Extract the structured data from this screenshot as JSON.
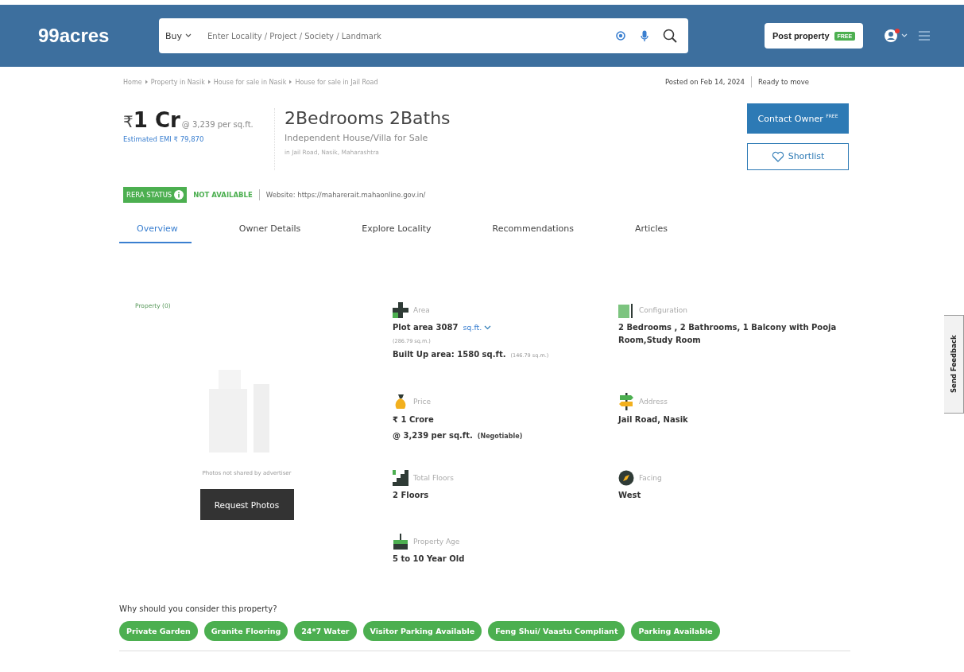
{
  "header": {
    "logo": "99acres",
    "search": {
      "mode": "Buy",
      "placeholder": "Enter Locality / Project / Society / Landmark"
    },
    "post_button": {
      "label": "Post property",
      "badge": "FREE"
    }
  },
  "breadcrumb": [
    "Home",
    "Property in Nasik",
    "House for sale in Nasik",
    "House for sale in Jail Road"
  ],
  "posted": "Posted on Feb 14, 2024",
  "availability": "Ready to move",
  "price": {
    "currency": "₹",
    "amount": "1 Cr",
    "rate": "@ 3,239 per sq.ft.",
    "emi": "Estimated EMI ₹ 79,870"
  },
  "title": "2Bedrooms 2Baths",
  "subtitle": "Independent House/Villa for Sale",
  "location": "in Jail Road, Nasik, Maharashtra",
  "contact_button": {
    "label": "Contact Owner",
    "badge": "FREE"
  },
  "shortlist_button": "Shortlist",
  "rera": {
    "label": "RERA STATUS",
    "status": "NOT AVAILABLE",
    "website": "Website: https://maharerait.mahaonline.gov.in/"
  },
  "tabs": [
    {
      "label": "Overview",
      "selected": true
    },
    {
      "label": "Owner Details",
      "selected": false
    },
    {
      "label": "Explore Locality",
      "selected": false
    },
    {
      "label": "Recommendations",
      "selected": false
    },
    {
      "label": "Articles",
      "selected": false
    }
  ],
  "photos": {
    "count_label": "Property (0)",
    "note": "Photos not shared by advertiser",
    "button": "Request Photos"
  },
  "details": [
    {
      "label": "Area",
      "lines": [
        {
          "kind": "value",
          "text": "Plot area 3087",
          "unit": "sq.ft."
        },
        {
          "kind": "small",
          "text": "(286.79 sq.m.)"
        },
        {
          "kind": "value",
          "text": "Built Up area: 1580 sq.ft.",
          "note": "(146.79 sq.m.)"
        }
      ]
    },
    {
      "label": "Configuration",
      "lines": [
        {
          "kind": "value",
          "text": "2 Bedrooms , 2 Bathrooms, 1 Balcony with Pooja Room,Study Room"
        }
      ]
    },
    {
      "label": "Price",
      "lines": [
        {
          "kind": "value",
          "text": "₹ 1 Crore"
        },
        {
          "kind": "value",
          "text": "@ 3,239 per sq.ft.",
          "note": "(Negotiable)"
        }
      ]
    },
    {
      "label": "Address",
      "lines": [
        {
          "kind": "value",
          "text": "Jail Road, Nasik"
        }
      ]
    },
    {
      "label": "Total Floors",
      "lines": [
        {
          "kind": "value",
          "text": "2 Floors"
        }
      ]
    },
    {
      "label": "Facing",
      "lines": [
        {
          "kind": "value",
          "text": "West"
        }
      ]
    },
    {
      "label": "Property Age",
      "lines": [
        {
          "kind": "value",
          "text": "5 to 10 Year Old"
        }
      ]
    }
  ],
  "why": {
    "heading": "Why should you consider this property?",
    "tags": [
      "Private Garden",
      "Granite Flooring",
      "24*7 Water",
      "Visitor Parking Available",
      "Feng Shui/ Vaastu Compliant",
      "Parking Available"
    ]
  },
  "feedback_tab": "Send Feedback"
}
